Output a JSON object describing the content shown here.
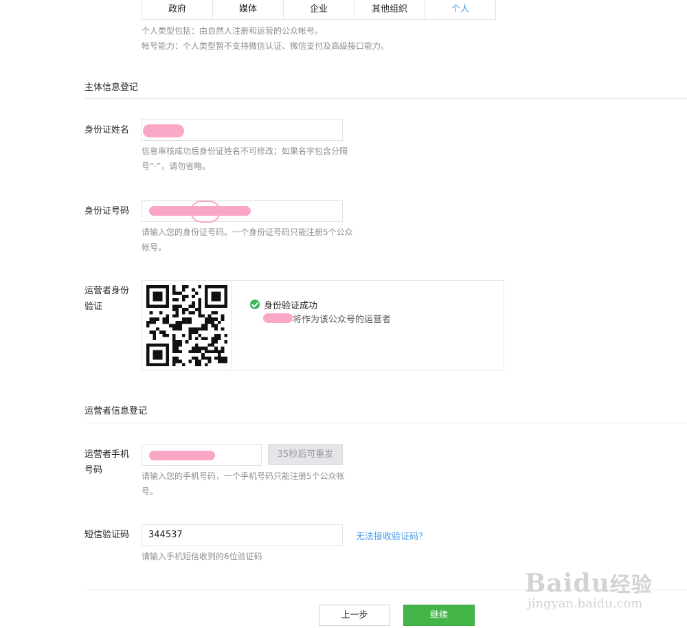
{
  "account_types": {
    "tabs": [
      "政府",
      "媒体",
      "企业",
      "其他组织",
      "个人"
    ],
    "active_index": 4,
    "desc_line1": "个人类型包括：由自然人注册和运营的公众帐号。",
    "desc_line2": "帐号能力：个人类型暂不支持微信认证、微信支付及高级接口能力。"
  },
  "subject_section": {
    "title": "主体信息登记",
    "id_name": {
      "label": "身份证姓名",
      "hint_line1": "信息审核成功后身份证姓名不可修改；如果名字包含分隔",
      "hint_line2": "号“·”，请勿省略。"
    },
    "id_number": {
      "label": "身份证号码",
      "hint_line1": "请输入您的身份证号码。一个身份证号码只能注册5个公众",
      "hint_line2": "帐号。"
    },
    "operator_verify": {
      "label_line1": "运营者身份",
      "label_line2": "验证",
      "status_title": "身份验证成功",
      "status_desc": "将作为该公众号的运营者"
    }
  },
  "operator_section": {
    "title": "运营者信息登记",
    "phone": {
      "label_line1": "运营者手机",
      "label_line2": "号码",
      "resend_label": "35秒后可重发",
      "hint_line1": "请输入您的手机号码，一个手机号码只能注册5个公众帐",
      "hint_line2": "号。"
    },
    "sms": {
      "label": "短信验证码",
      "value": "344537",
      "cannot_receive": "无法接收验证码？",
      "hint": "请输入手机短信收到的6位验证码"
    }
  },
  "actions": {
    "prev": "上一步",
    "next": "继续"
  },
  "watermark": {
    "brand": "Baidu",
    "cn": "经验",
    "url": "jingyan.baidu.com"
  },
  "colors": {
    "accent": "#459ae9",
    "primary_button": "#44b549",
    "success": "#3bb55b"
  }
}
